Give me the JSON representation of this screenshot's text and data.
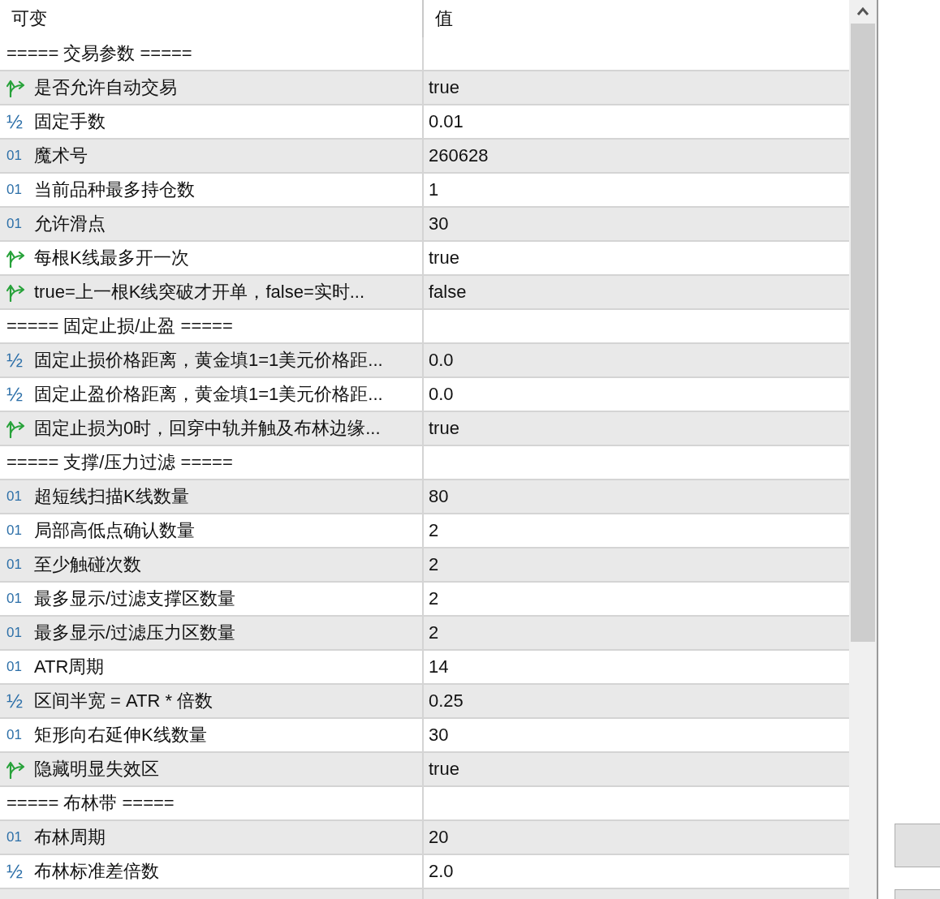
{
  "table": {
    "columns": [
      "可变",
      "值"
    ],
    "rows": [
      {
        "kind": "section",
        "name": "===== 交易参数 =====",
        "value": ""
      },
      {
        "kind": "bool",
        "name": "是否允许自动交易",
        "value": "true"
      },
      {
        "kind": "double",
        "mark": "½",
        "name": "固定手数",
        "value": "0.01"
      },
      {
        "kind": "int",
        "mark": "01",
        "name": "魔术号",
        "value": "260628"
      },
      {
        "kind": "int",
        "mark": "01",
        "name": "当前品种最多持仓数",
        "value": "1"
      },
      {
        "kind": "int",
        "mark": "01",
        "name": "允许滑点",
        "value": "30"
      },
      {
        "kind": "bool",
        "name": "每根K线最多开一次",
        "value": "true"
      },
      {
        "kind": "bool",
        "name": "true=上一根K线突破才开单，false=实时...",
        "value": "false"
      },
      {
        "kind": "section",
        "name": "===== 固定止损/止盈 =====",
        "value": ""
      },
      {
        "kind": "double",
        "mark": "½",
        "name": "固定止损价格距离，黄金填1=1美元价格距...",
        "value": "0.0"
      },
      {
        "kind": "double",
        "mark": "½",
        "name": "固定止盈价格距离，黄金填1=1美元价格距...",
        "value": "0.0"
      },
      {
        "kind": "bool",
        "name": "固定止损为0时，回穿中轨并触及布林边缘...",
        "value": "true"
      },
      {
        "kind": "section",
        "name": "===== 支撑/压力过滤 =====",
        "value": ""
      },
      {
        "kind": "int",
        "mark": "01",
        "name": "超短线扫描K线数量",
        "value": "80"
      },
      {
        "kind": "int",
        "mark": "01",
        "name": "局部高低点确认数量",
        "value": "2"
      },
      {
        "kind": "int",
        "mark": "01",
        "name": "至少触碰次数",
        "value": "2"
      },
      {
        "kind": "int",
        "mark": "01",
        "name": "最多显示/过滤支撑区数量",
        "value": "2"
      },
      {
        "kind": "int",
        "mark": "01",
        "name": "最多显示/过滤压力区数量",
        "value": "2"
      },
      {
        "kind": "int",
        "mark": "01",
        "name": "ATR周期",
        "value": "14"
      },
      {
        "kind": "double",
        "mark": "½",
        "name": "区间半宽 = ATR * 倍数",
        "value": "0.25"
      },
      {
        "kind": "int",
        "mark": "01",
        "name": "矩形向右延伸K线数量",
        "value": "30"
      },
      {
        "kind": "bool",
        "name": "隐藏明显失效区",
        "value": "true"
      },
      {
        "kind": "section",
        "name": "===== 布林带 =====",
        "value": ""
      },
      {
        "kind": "int",
        "mark": "01",
        "name": "布林周期",
        "value": "20"
      },
      {
        "kind": "double",
        "mark": "½",
        "name": "布林标准差倍数",
        "value": "2.0"
      }
    ]
  }
}
